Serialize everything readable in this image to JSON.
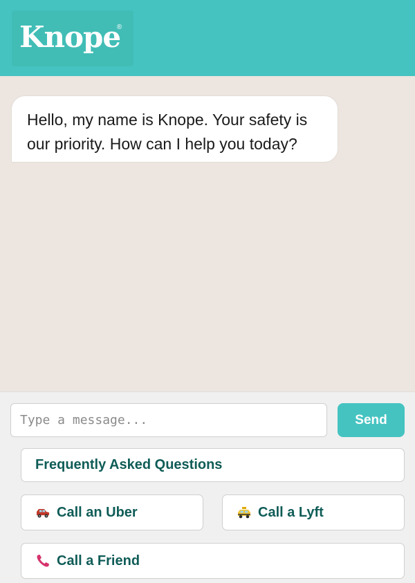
{
  "header": {
    "logo_text": "Knope",
    "logo_mark": "®",
    "accent_color": "#45c3c1"
  },
  "chat": {
    "messages": [
      {
        "sender": "bot",
        "text": "Hello, my name is Knope. Your safety is our priority. How can I help you today?"
      }
    ]
  },
  "composer": {
    "placeholder": "Type a message...",
    "send_label": "Send"
  },
  "quick_actions": {
    "faq": {
      "label": "Frequently Asked Questions"
    },
    "uber": {
      "label": "Call an Uber",
      "icon": "car-icon"
    },
    "lyft": {
      "label": "Call a Lyft",
      "icon": "taxi-icon"
    },
    "friend": {
      "label": "Call a Friend",
      "icon": "phone-icon"
    }
  }
}
